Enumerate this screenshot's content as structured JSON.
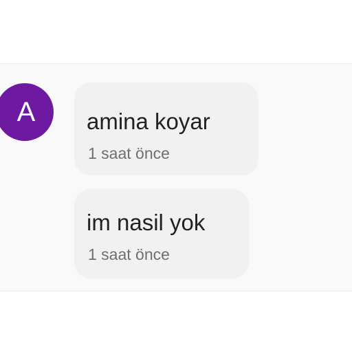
{
  "sender": {
    "avatar_letter": "A",
    "avatar_color": "#6e1aa0"
  },
  "messages": [
    {
      "text": "amina koyar",
      "time": "1 saat önce"
    },
    {
      "text": "im nasil yok",
      "time": "1 saat önce"
    }
  ]
}
